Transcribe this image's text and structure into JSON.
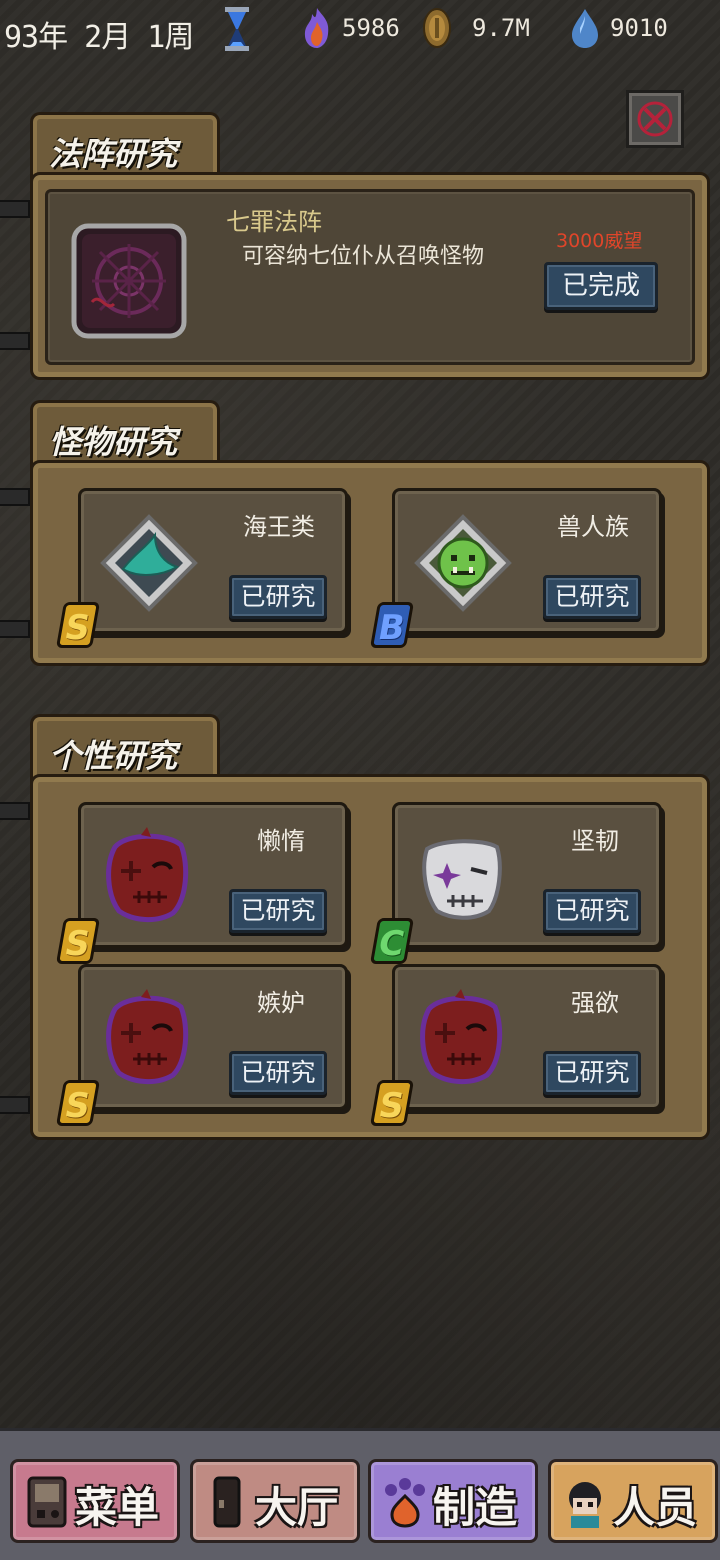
{
  "status": {
    "date": "93年 2月 1周",
    "flame": "5986",
    "coin": "9.7M",
    "crystal": "9010"
  },
  "sections": {
    "array": {
      "title": "法阵研究",
      "name": "七罪法阵",
      "desc": "可容纳七位仆从召唤怪物",
      "cost": "3000威望",
      "button": "已完成"
    },
    "monster": {
      "title": "怪物研究",
      "cards": [
        {
          "name": "海王类",
          "grade": "S",
          "button": "已研究",
          "icon": "fish-fin-icon"
        },
        {
          "name": "兽人族",
          "grade": "B",
          "button": "已研究",
          "icon": "orc-face-icon"
        }
      ]
    },
    "trait": {
      "title": "个性研究",
      "cards": [
        {
          "name": "懒惰",
          "grade": "S",
          "button": "已研究",
          "icon": "red-mask-icon"
        },
        {
          "name": "坚韧",
          "grade": "C",
          "button": "已研究",
          "icon": "white-mask-icon"
        },
        {
          "name": "嫉妒",
          "grade": "S",
          "button": "已研究",
          "icon": "red-mask-icon"
        },
        {
          "name": "强欲",
          "grade": "S",
          "button": "已研究",
          "icon": "red-mask-icon"
        }
      ]
    }
  },
  "nav": [
    {
      "label": "菜单",
      "color": "#c77a8e"
    },
    {
      "label": "大厅",
      "color": "#bf8b83"
    },
    {
      "label": "制造",
      "color": "#9a7fd2"
    },
    {
      "label": "人员",
      "color": "#d7a35e"
    }
  ]
}
